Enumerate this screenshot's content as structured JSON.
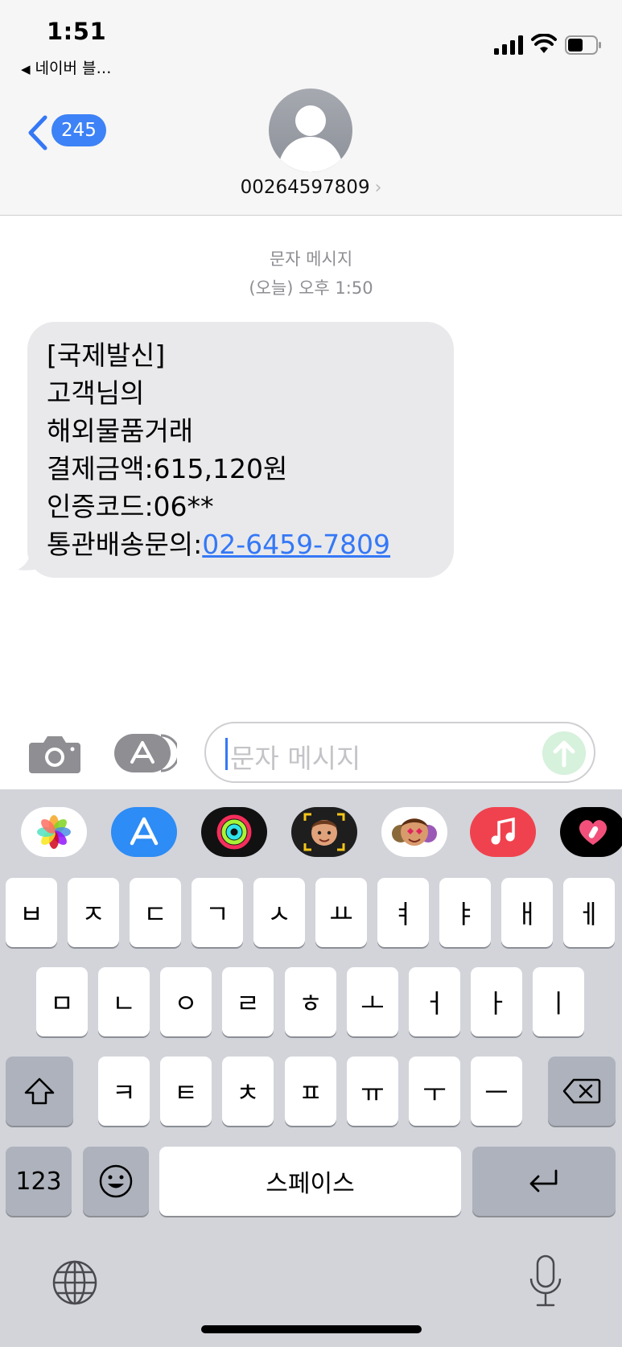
{
  "status_bar": {
    "time": "1:51",
    "back_app": "네이버 블…"
  },
  "header": {
    "back_count": "245",
    "contact": "00264597809"
  },
  "thread": {
    "service": "문자 메시지",
    "timestamp": "(오늘) 오후 1:50",
    "message": {
      "lines": [
        "[국제발신]",
        "고객님의",
        "해외물품거래",
        "결제금액:615,120원",
        "인증코드:06**"
      ],
      "last_prefix": "통관배송문의:",
      "phone_link": "02-6459-7809"
    }
  },
  "input": {
    "placeholder": "문자 메시지"
  },
  "keyboard": {
    "row1": [
      "ㅂ",
      "ㅈ",
      "ㄷ",
      "ㄱ",
      "ㅅ",
      "ㅛ",
      "ㅕ",
      "ㅑ",
      "ㅐ",
      "ㅔ"
    ],
    "row2": [
      "ㅁ",
      "ㄴ",
      "ㅇ",
      "ㄹ",
      "ㅎ",
      "ㅗ",
      "ㅓ",
      "ㅏ",
      "ㅣ"
    ],
    "row3": [
      "ㅋ",
      "ㅌ",
      "ㅊ",
      "ㅍ",
      "ㅠ",
      "ㅜ",
      "ㅡ"
    ],
    "numbers_label": "123",
    "space_label": "스페이스"
  },
  "colors": {
    "accent": "#3478f6",
    "bubble": "#e9e9eb",
    "keyboard_bg": "#d2d4da",
    "send_disabled": "#d6f1dc"
  }
}
